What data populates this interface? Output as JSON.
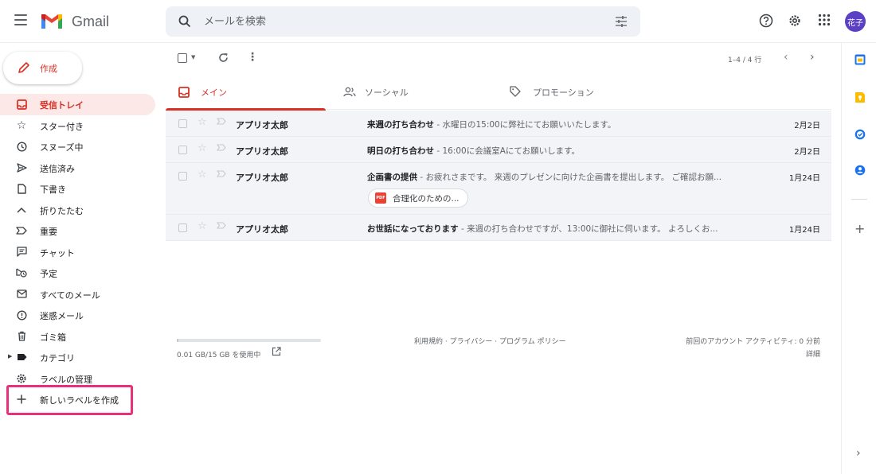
{
  "app": {
    "name": "Gmail"
  },
  "colors": {
    "accent": "#d93025",
    "highlight": "#e8317a",
    "avatar": "#5b3fc4"
  },
  "search": {
    "placeholder": "メールを検索"
  },
  "account": {
    "avatar_text": "花子"
  },
  "compose": {
    "label": "作成"
  },
  "sidebar": {
    "items": [
      {
        "label": "受信トレイ",
        "icon": "inbox-icon",
        "active": true
      },
      {
        "label": "スター付き",
        "icon": "star-icon"
      },
      {
        "label": "スヌーズ中",
        "icon": "clock-icon"
      },
      {
        "label": "送信済み",
        "icon": "send-icon"
      },
      {
        "label": "下書き",
        "icon": "draft-icon"
      },
      {
        "label": "折りたたむ",
        "icon": "chevron-up-icon"
      },
      {
        "label": "重要",
        "icon": "important-icon"
      },
      {
        "label": "チャット",
        "icon": "chat-icon"
      },
      {
        "label": "予定",
        "icon": "scheduled-icon"
      },
      {
        "label": "すべてのメール",
        "icon": "all-mail-icon"
      },
      {
        "label": "迷惑メール",
        "icon": "spam-icon"
      },
      {
        "label": "ゴミ箱",
        "icon": "trash-icon"
      },
      {
        "label": "カテゴリ",
        "icon": "label-icon"
      },
      {
        "label": "ラベルの管理",
        "icon": "gear-icon"
      },
      {
        "label": "新しいラベルを作成",
        "icon": "plus-icon"
      }
    ]
  },
  "toolbar": {
    "pagination": "1–4 / 4 行"
  },
  "tabs": [
    {
      "label": "メイン",
      "icon": "inbox-icon",
      "active": true
    },
    {
      "label": "ソーシャル",
      "icon": "people-icon"
    },
    {
      "label": "プロモーション",
      "icon": "tag-icon"
    }
  ],
  "emails": [
    {
      "sender": "アプリオ太郎",
      "subject": "来週の打ち合わせ",
      "snippet": " - 水曜日の15:00に弊社にてお願いいたします。",
      "date": "2月2日"
    },
    {
      "sender": "アプリオ太郎",
      "subject": "明日の打ち合わせ",
      "snippet": " - 16:00に会議室Aにてお願いします。",
      "date": "2月2日"
    },
    {
      "sender": "アプリオ太郎",
      "subject": "企画書の提供",
      "snippet": " - お疲れさまです。 来週のプレゼンに向けた企画書を提出します。 ご確認お願...",
      "date": "1月24日",
      "attachment": {
        "label": "合理化のための...",
        "type_label": "PDF"
      }
    },
    {
      "sender": "アプリオ太郎",
      "subject": "お世話になっております",
      "snippet": " - 来週の打ち合わせですが、13:00に御社に伺います。 よろしくお...",
      "date": "1月24日"
    }
  ],
  "footer": {
    "storage": "0.01 GB/15 GB を使用中",
    "storage_fraction": 0.01,
    "links": "利用規約 · プライバシー · プログラム ポリシー",
    "activity": "前回のアカウント アクティビティ: 0 分前",
    "details": "詳細"
  }
}
